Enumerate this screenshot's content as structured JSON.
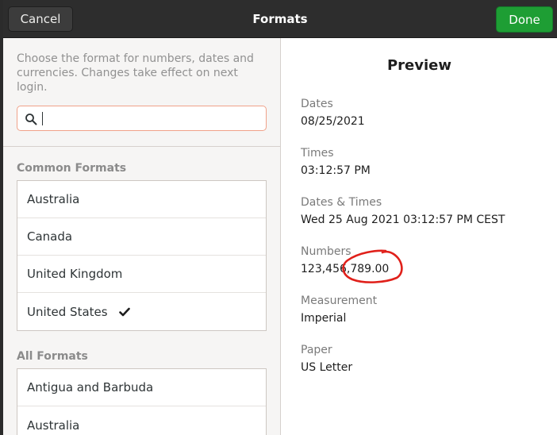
{
  "header": {
    "cancel_label": "Cancel",
    "title": "Formats",
    "done_label": "Done",
    "done_color": "#1e9e34"
  },
  "left": {
    "description": "Choose the format for numbers, dates and currencies. Changes take effect on next login.",
    "search": {
      "value": "",
      "placeholder": ""
    },
    "common_label": "Common Formats",
    "common_items": [
      {
        "label": "Australia",
        "selected": false
      },
      {
        "label": "Canada",
        "selected": false
      },
      {
        "label": "United Kingdom",
        "selected": false
      },
      {
        "label": "United States",
        "selected": true
      }
    ],
    "all_label": "All Formats",
    "all_items": [
      {
        "label": "Antigua and Barbuda"
      },
      {
        "label": "Australia"
      }
    ]
  },
  "preview": {
    "title": "Preview",
    "items": [
      {
        "label": "Dates",
        "value": "08/25/2021"
      },
      {
        "label": "Times",
        "value": "03:12:57 PM"
      },
      {
        "label": "Dates & Times",
        "value": "Wed 25 Aug 2021 03:12:57 PM CEST"
      },
      {
        "label": "Numbers",
        "value": "123,456,789.00"
      },
      {
        "label": "Measurement",
        "value": "Imperial"
      },
      {
        "label": "Paper",
        "value": "US Letter"
      }
    ]
  },
  "icons": {
    "search": "search-icon",
    "checkmark": "checkmark-icon",
    "annotation": "red-circle-annotation"
  },
  "annotation_color": "#e0201a"
}
